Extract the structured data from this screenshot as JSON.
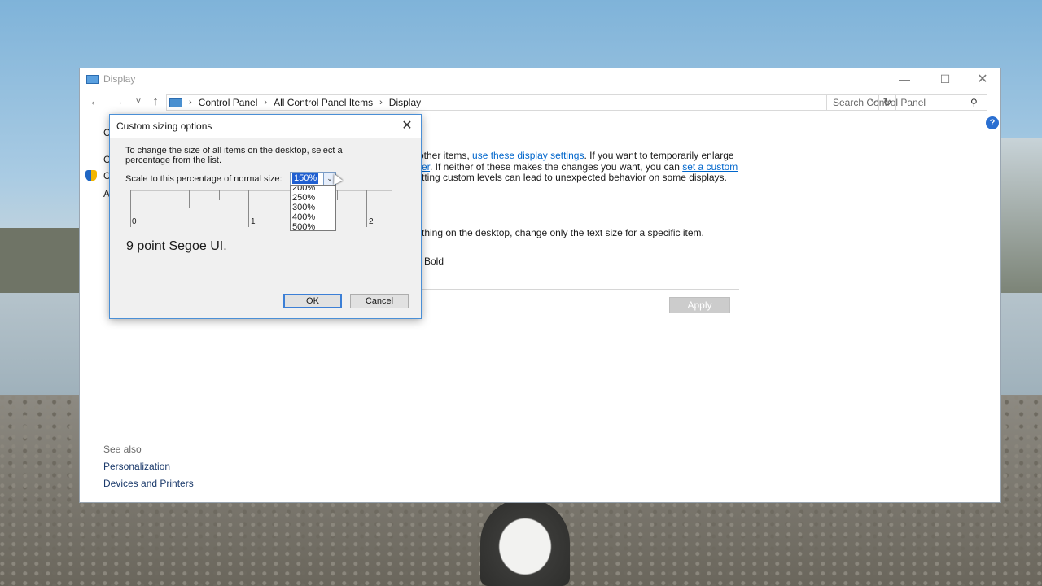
{
  "window": {
    "title": "Display",
    "min_glyph": "—",
    "max_glyph": "☐",
    "close_glyph": "✕"
  },
  "nav": {
    "back": "←",
    "forward": "→",
    "recent": "˅",
    "up": "↑",
    "breadcrumbs": [
      "Control Panel",
      "All Control Panel Items",
      "Display"
    ],
    "breadcrumb_sep": "›",
    "dropdown": "⌵",
    "refresh": "↻",
    "search_placeholder": "Search Control Panel",
    "search_icon": "⚲",
    "help": "?"
  },
  "main": {
    "left_fragments": [
      "C",
      "C",
      "C",
      "A"
    ],
    "line1_pre": "other items, ",
    "line1_link": "use these display settings",
    "line1_post": ".  If you want to temporarily enlarge",
    "line2_link": "er",
    "line2_mid": ".  If neither of these makes the changes you want, you can ",
    "line2_link2": "set a custom",
    "line3": "tting custom levels can lead to unexpected behavior on some displays.",
    "line4": "thing on the desktop, change only the text size for a specific item.",
    "bold_label": "Bold",
    "apply": "Apply"
  },
  "see_also": {
    "heading": "See also",
    "links": [
      "Personalization",
      "Devices and Printers"
    ]
  },
  "dialog": {
    "title": "Custom sizing options",
    "close": "✕",
    "instructions": "To change the size of all items on the desktop, select a percentage from the list.",
    "scale_label": "Scale to this percentage of normal size:",
    "selected": "150%",
    "arrow": "⌄",
    "options": [
      "200%",
      "250%",
      "300%",
      "400%",
      "500%"
    ],
    "ruler_labels": [
      "0",
      "1",
      "2"
    ],
    "sample_text": "9 point Segoe UI.",
    "ok": "OK",
    "cancel": "Cancel"
  },
  "colors": {
    "accent": "#0066cc",
    "dialog_border": "#4a8fd6",
    "selection": "#1f5fd1"
  }
}
